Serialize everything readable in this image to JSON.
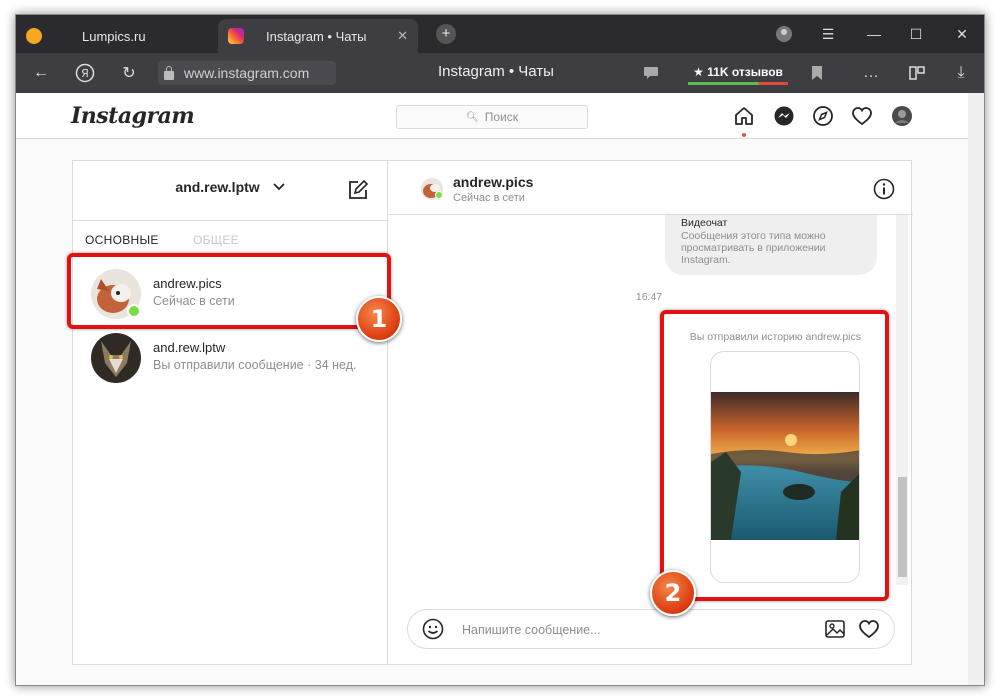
{
  "browser": {
    "tabs": [
      {
        "label": "Lumpics.ru"
      },
      {
        "label": "Instagram • Чаты"
      }
    ],
    "url": "www.instagram.com",
    "page_title": "Instagram • Чаты",
    "reviews_label": "★ 11K отзывов"
  },
  "instagram": {
    "logo": "Instagram",
    "search_placeholder": "Поиск",
    "nav_icons": [
      "home-icon",
      "messenger-icon",
      "explore-icon",
      "heart-icon",
      "profile-avatar"
    ]
  },
  "inbox": {
    "account_name": "and.rew.lptw",
    "tabs": [
      {
        "label": "ОСНОВНЫЕ",
        "active": true
      },
      {
        "label": "ОБЩЕЕ",
        "active": false
      }
    ],
    "conversations": [
      {
        "name": "andrew.pics",
        "status": "Сейчас в сети",
        "online": true
      },
      {
        "name": "and.rew.lptw",
        "status": "Вы отправили сообщение · 34 нед.",
        "online": false
      }
    ]
  },
  "chat": {
    "name": "andrew.pics",
    "status": "Сейчас в сети",
    "bubble_title": "Видеочат",
    "bubble_text": "Сообщения этого типа можно просматривать в приложении Instagram.",
    "time": "16:47",
    "story_label": "Вы отправили историю andrew.pics",
    "composer_placeholder": "Напишите сообщение..."
  },
  "annotations": {
    "badge1": "1",
    "badge2": "2",
    "highlight_color": "#e51010"
  }
}
